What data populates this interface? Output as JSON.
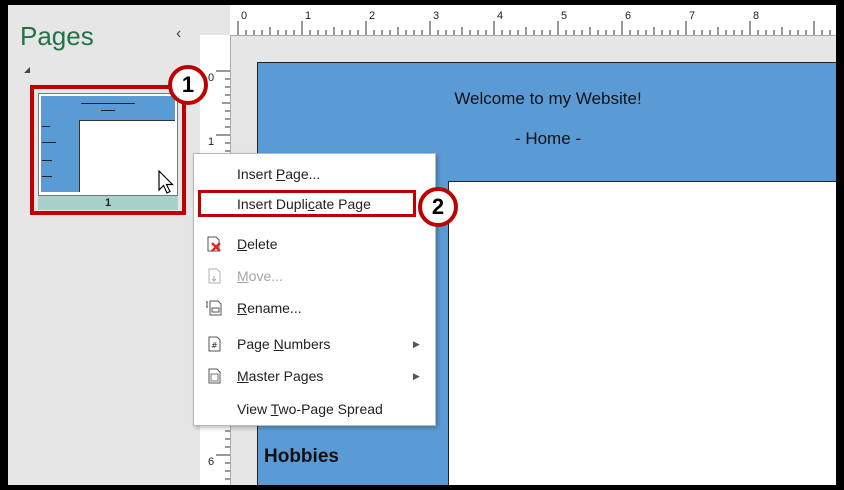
{
  "pages_pane": {
    "title": "Pages",
    "collapse_glyph": "‹",
    "thumbnail": {
      "page_number": "1",
      "header_text": "Welcome to my Website! - Home -"
    }
  },
  "ruler": {
    "h_labels": [
      "0",
      "1",
      "2",
      "3",
      "4",
      "5",
      "6",
      "7",
      "8"
    ],
    "v_labels": [
      "0",
      "1",
      "6"
    ]
  },
  "document": {
    "title": "Welcome to my Website!",
    "subtitle": "- Home -",
    "sidebar_heading": "Hobbies"
  },
  "context_menu": {
    "items": [
      {
        "pre": "Insert ",
        "key": "P",
        "post": "age...",
        "icon": "",
        "disabled": false,
        "submenu": false
      },
      {
        "pre": "Insert Dupli",
        "key": "c",
        "post": "ate Page",
        "icon": "",
        "disabled": false,
        "submenu": false
      },
      {
        "pre": "",
        "key": "D",
        "post": "elete",
        "icon": "delete-page-icon",
        "disabled": false,
        "submenu": false
      },
      {
        "pre": "",
        "key": "M",
        "post": "ove...",
        "icon": "move-page-icon",
        "disabled": true,
        "submenu": false
      },
      {
        "pre": "",
        "key": "R",
        "post": "ename...",
        "icon": "rename-page-icon",
        "disabled": false,
        "submenu": false
      },
      {
        "pre": "Page ",
        "key": "N",
        "post": "umbers",
        "icon": "page-numbers-icon",
        "disabled": false,
        "submenu": true
      },
      {
        "pre": "",
        "key": "M",
        "post": "aster Pages",
        "icon": "master-pages-icon",
        "disabled": false,
        "submenu": true
      },
      {
        "pre": "View ",
        "key": "T",
        "post": "wo-Page Spread",
        "icon": "",
        "disabled": false,
        "submenu": false
      }
    ]
  },
  "callouts": {
    "step1": "1",
    "step2": "2"
  },
  "colors": {
    "accent_red": "#c00000",
    "page_blue": "#5b9bd5",
    "pages_title_green": "#217346",
    "thumb_number_bar": "#a8d1cc"
  }
}
